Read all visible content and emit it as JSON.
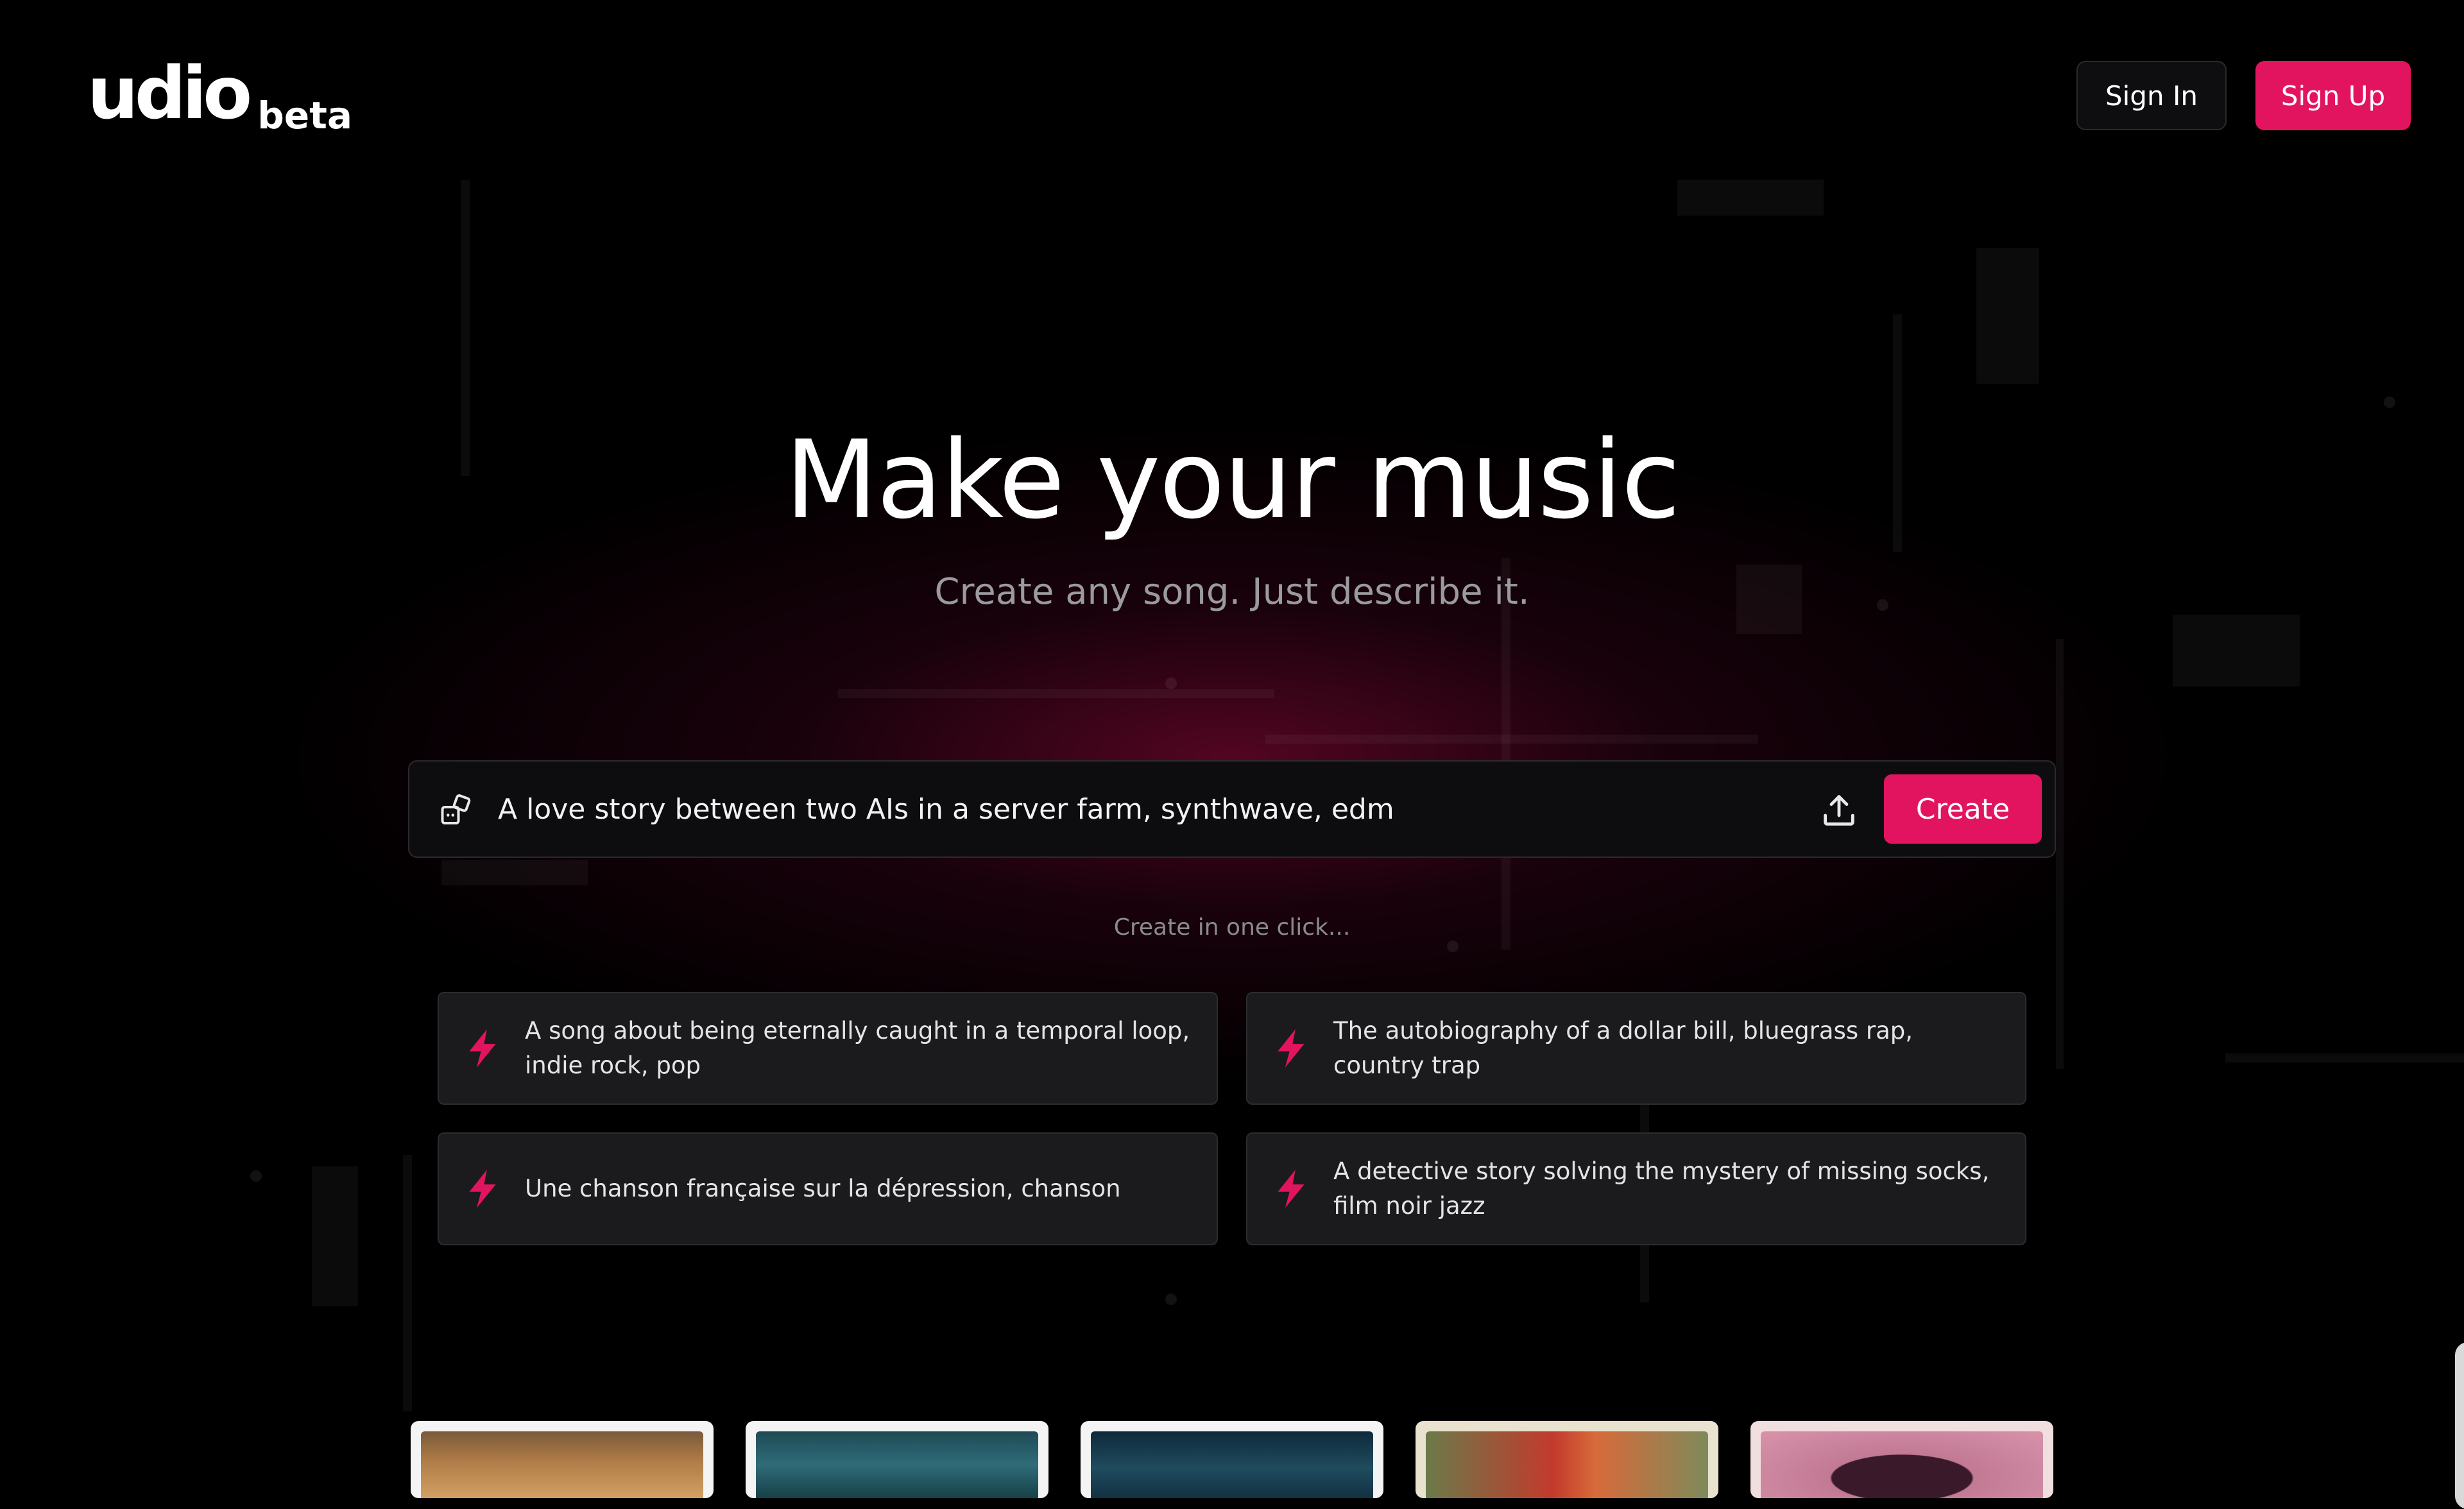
{
  "header": {
    "logo_text": "udio",
    "logo_badge": "beta",
    "sign_in_label": "Sign In",
    "sign_up_label": "Sign Up"
  },
  "hero": {
    "title": "Make your music",
    "subtitle": "Create any song. Just describe it."
  },
  "prompt": {
    "value": "A love story between two AIs in a server farm, synthwave, edm",
    "icon": "dice-icon",
    "upload_icon": "upload-icon",
    "create_label": "Create"
  },
  "one_click": {
    "label": "Create in one click...",
    "suggestions": [
      "A song about being eternally caught in a temporal loop, indie rock, pop",
      "The autobiography of a dollar bill, bluegrass rap, country trap",
      "Une chanson française sur la dépression, chanson",
      "A detective story solving the mystery of missing socks, film noir jazz"
    ]
  },
  "colors": {
    "accent": "#e3145f",
    "background": "#000000",
    "card_bg": "#1b1b1e",
    "muted_text": "#9a9a9f"
  }
}
